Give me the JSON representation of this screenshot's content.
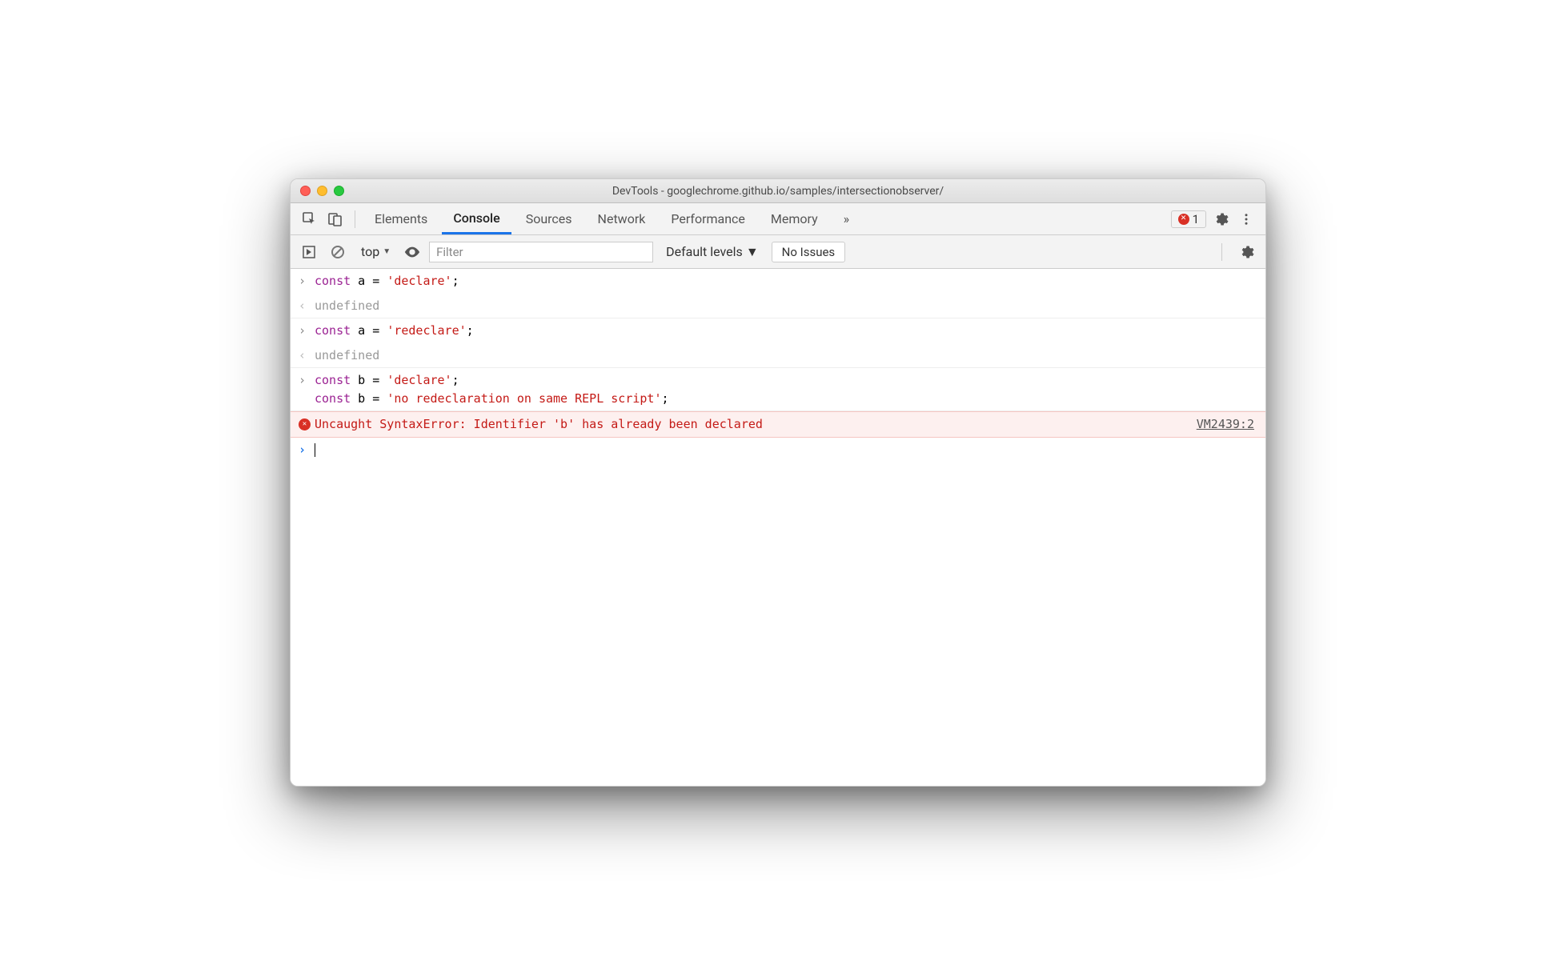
{
  "window": {
    "title": "DevTools - googlechrome.github.io/samples/intersectionobserver/"
  },
  "tabs": {
    "items": [
      "Elements",
      "Console",
      "Sources",
      "Network",
      "Performance",
      "Memory"
    ],
    "active": "Console",
    "overflow_glyph": "»",
    "error_count": "1"
  },
  "toolbar": {
    "context": "top",
    "filter_placeholder": "Filter",
    "levels": "Default levels",
    "issues": "No Issues"
  },
  "console": {
    "entries": [
      {
        "type": "input",
        "tokens": [
          [
            "kw",
            "const"
          ],
          [
            "",
            " a = "
          ],
          [
            "str",
            "'declare'"
          ],
          [
            "",
            ";"
          ]
        ]
      },
      {
        "type": "output",
        "text": "undefined"
      },
      {
        "type": "input",
        "tokens": [
          [
            "kw",
            "const"
          ],
          [
            "",
            " a = "
          ],
          [
            "str",
            "'redeclare'"
          ],
          [
            "",
            ";"
          ]
        ]
      },
      {
        "type": "output",
        "text": "undefined"
      },
      {
        "type": "input-multi",
        "lines": [
          [
            [
              "kw",
              "const"
            ],
            [
              "",
              " b = "
            ],
            [
              "str",
              "'declare'"
            ],
            [
              "",
              ";"
            ]
          ],
          [
            [
              "kw",
              "const"
            ],
            [
              "",
              " b = "
            ],
            [
              "str",
              "'no redeclaration on same REPL script'"
            ],
            [
              "",
              ";"
            ]
          ]
        ]
      },
      {
        "type": "error",
        "text": "Uncaught SyntaxError: Identifier 'b' has already been declared",
        "source": "VM2439:2"
      }
    ]
  }
}
